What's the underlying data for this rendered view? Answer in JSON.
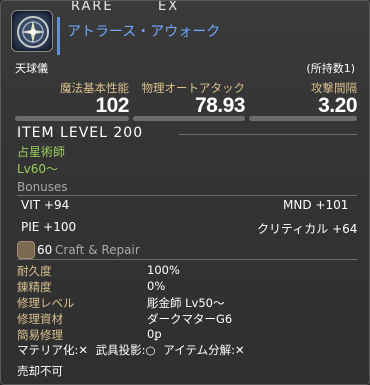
{
  "header": {
    "rarity_1": "RARE",
    "rarity_2": "EX",
    "item_name": "アトラース・アウォーク",
    "category": "天球儀",
    "owned": "(所持数1)"
  },
  "stats": [
    {
      "label": "魔法基本性能",
      "value": "102"
    },
    {
      "label": "物理オートアタック",
      "value": "78.93"
    },
    {
      "label": "攻撃間隔",
      "value": "3.20"
    }
  ],
  "item_level": "ITEM LEVEL 200",
  "job": "占星術師",
  "required_level": "Lv60～",
  "bonuses": {
    "title": "Bonuses",
    "items": [
      {
        "text": "VIT +94"
      },
      {
        "text": "MND +101"
      },
      {
        "text": "PIE +100"
      },
      {
        "text": "クリティカル +64"
      }
    ]
  },
  "craft": {
    "level": "60",
    "title": "Craft & Repair"
  },
  "repair": [
    {
      "label": "耐久度",
      "value": "100%"
    },
    {
      "label": "錬精度",
      "value": "0%"
    },
    {
      "label": "修理レベル",
      "value": "彫金師 Lv50～"
    },
    {
      "label": "修理資材",
      "value": "ダークマターG6"
    },
    {
      "label": "簡易修理",
      "value": "0ꝑ"
    }
  ],
  "flags": {
    "materia": "マテリア化:✕",
    "glamour": "武具投影:○",
    "desynth": "アイテム分解:✕"
  },
  "untradable": "売却不可",
  "colors": {
    "item_name": "#6ea8ff",
    "stat_label": "#d9c08e",
    "job": "#9bcf5a",
    "accent": "#5f8fd8"
  },
  "icons": {
    "item": "astrologian-star-globe-icon",
    "craft": "craft-repair-icon"
  }
}
